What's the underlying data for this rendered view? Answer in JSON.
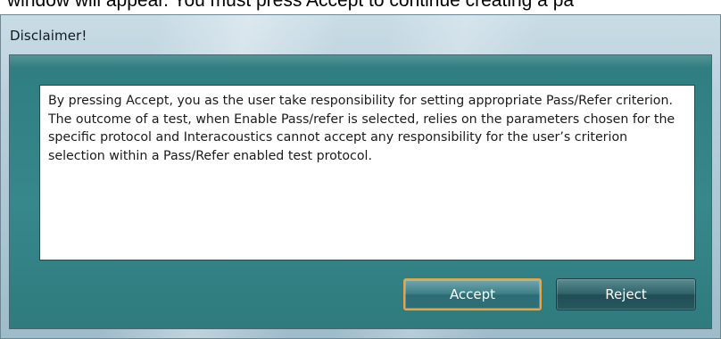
{
  "background_document": {
    "partial_text": "window will appear. You must press Accept to continue creating a pa"
  },
  "dialog": {
    "title": "Disclaimer!",
    "message": "By pressing Accept, you as the user take responsibility for setting appropriate Pass/Refer criterion.\nThe outcome of a test, when Enable Pass/refer is selected, relies on the parameters chosen for the specific protocol and Interacoustics cannot accept any responsibility for the user’s criterion selection within a Pass/Refer enabled test protocol.",
    "buttons": {
      "accept_label": "Accept",
      "reject_label": "Reject"
    }
  },
  "colors": {
    "client_background": "#37888b",
    "focus_border": "#f2a23a",
    "button_text": "#ffffff"
  }
}
